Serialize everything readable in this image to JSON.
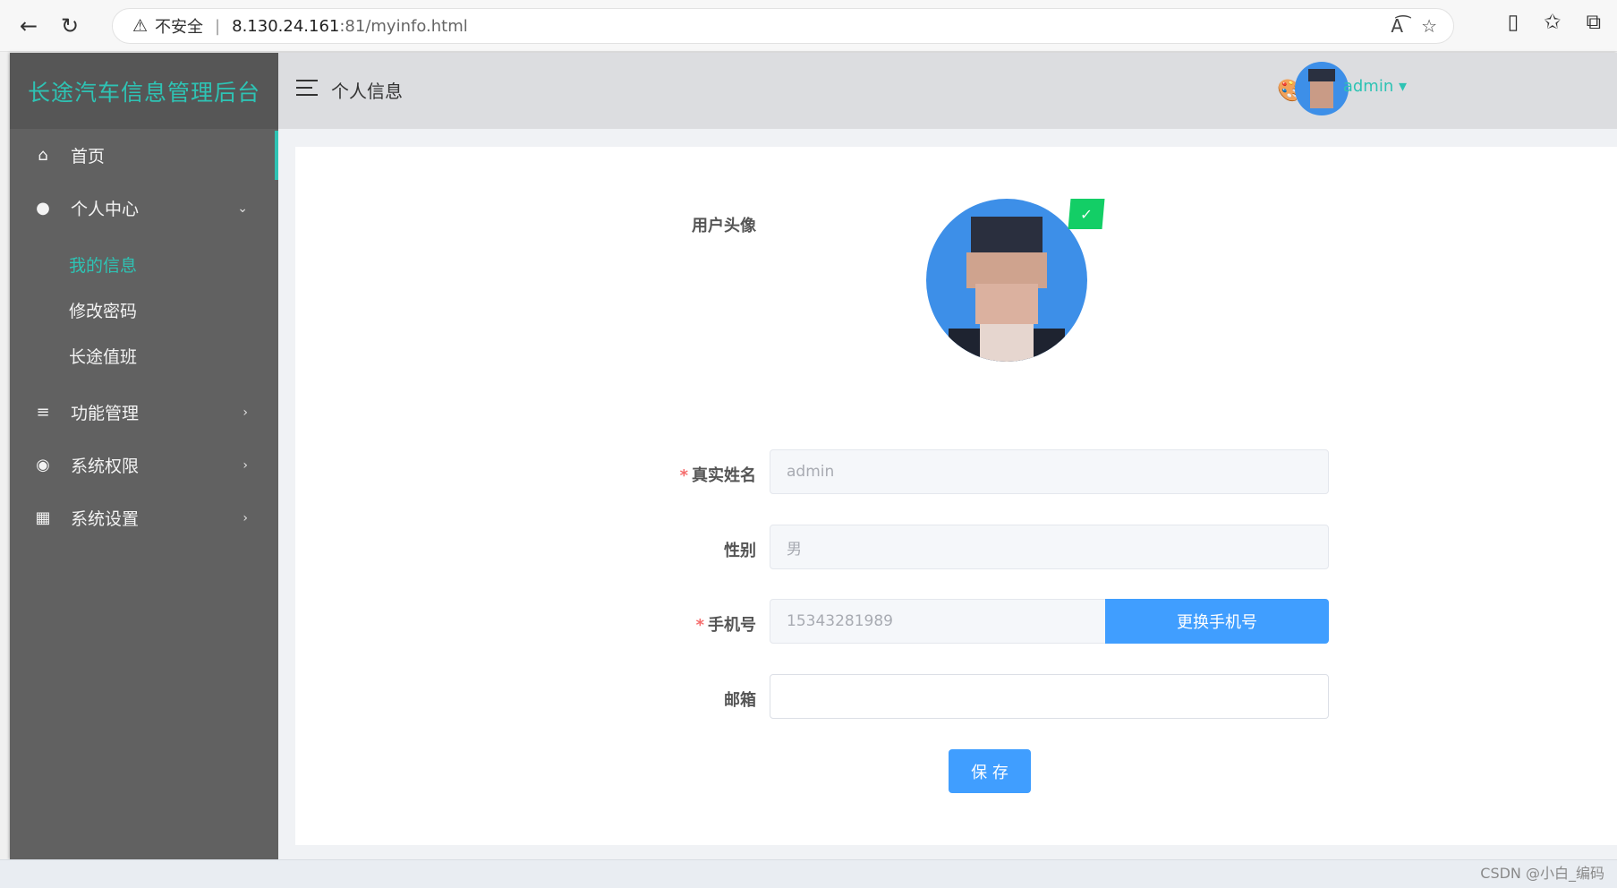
{
  "browser": {
    "back_icon": "arrow-left-icon",
    "reload_icon": "reload-icon",
    "insecure_label": "不安全",
    "url_host": "8.130.24.161",
    "url_rest": ":81/myinfo.html"
  },
  "app": {
    "logo_title": "长途汽车信息管理后台",
    "header_title": "个人信息",
    "user_name": "admin",
    "accent_color": "#2ec3b4"
  },
  "sidebar": {
    "items": [
      {
        "label": "首页",
        "icon": "home-icon"
      },
      {
        "label": "个人中心",
        "icon": "user-circle-icon"
      },
      {
        "label": "功能管理",
        "icon": "list-icon"
      },
      {
        "label": "系统权限",
        "icon": "github-icon"
      },
      {
        "label": "系统设置",
        "icon": "grid-icon"
      }
    ],
    "submenu": [
      "我的信息",
      "修改密码",
      "长途值班"
    ]
  },
  "form": {
    "avatar_label": "用户头像",
    "real_name_label": "真实姓名",
    "real_name_value": "admin",
    "gender_label": "性别",
    "gender_value": "男",
    "phone_label": "手机号",
    "phone_value": "15343281989",
    "change_phone_button": "更换手机号",
    "email_label": "邮箱",
    "email_value": "",
    "save_button": "保 存",
    "required_mark": "*"
  },
  "watermark": "CSDN @小白_编码"
}
